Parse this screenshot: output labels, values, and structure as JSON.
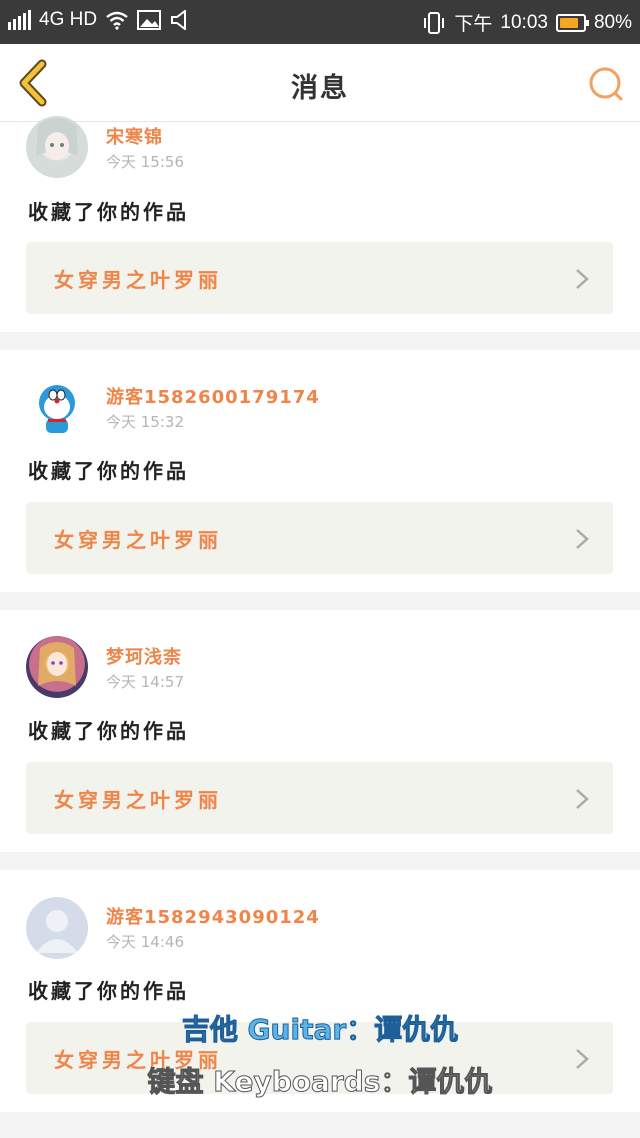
{
  "status": {
    "network": "4G HD",
    "ampm": "下午",
    "time": "10:03",
    "battery": "80%",
    "battery_level": 0.8
  },
  "header": {
    "title": "消息"
  },
  "messages": [
    {
      "user": "宋寒锦",
      "time": "今天 15:56",
      "action": "收藏了你的作品",
      "work": "女穿男之叶罗丽",
      "avatar": "anime-girl-avatar"
    },
    {
      "user": "游客1582600179174",
      "time": "今天 15:32",
      "action": "收藏了你的作品",
      "work": "女穿男之叶罗丽",
      "avatar": "doraemon-avatar"
    },
    {
      "user": "梦珂浅柰",
      "time": "今天 14:57",
      "action": "收藏了你的作品",
      "work": "女穿男之叶罗丽",
      "avatar": "anime-girl-avatar"
    },
    {
      "user": "游客1582943090124",
      "time": "今天 14:46",
      "action": "收藏了你的作品",
      "work": "女穿男之叶罗丽",
      "avatar": "default-user-avatar"
    }
  ],
  "subtitles": {
    "line1": "吉他 Guitar：谭仇仇",
    "line2": "键盘 Keyboards：谭仇仇"
  },
  "colors": {
    "accent": "#f0854a",
    "header_icon": "#f5a623"
  }
}
